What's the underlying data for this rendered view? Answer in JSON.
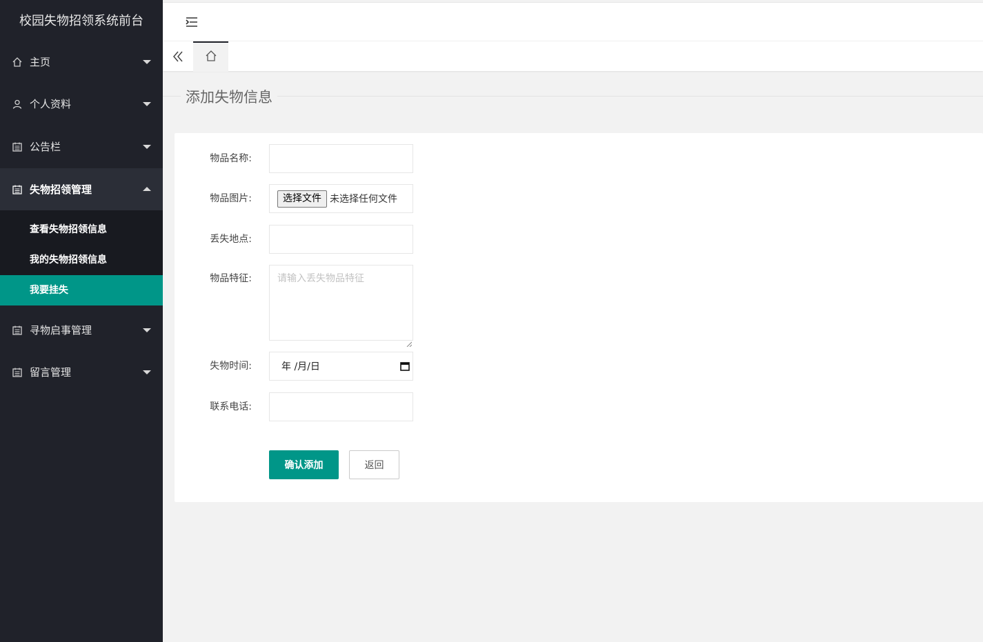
{
  "sidebar": {
    "brand": "校园失物招领系统前台",
    "items": [
      {
        "label": "主页",
        "icon": "home-icon"
      },
      {
        "label": "个人资料",
        "icon": "user-icon"
      },
      {
        "label": "公告栏",
        "icon": "calendar-icon"
      },
      {
        "label": "失物招领管理",
        "icon": "calendar-icon",
        "open": true,
        "children": [
          {
            "label": "查看失物招领信息"
          },
          {
            "label": "我的失物招领信息"
          },
          {
            "label": "我要挂失",
            "active": true
          }
        ]
      },
      {
        "label": "寻物启事管理",
        "icon": "calendar-icon"
      },
      {
        "label": "留言管理",
        "icon": "calendar-icon"
      }
    ]
  },
  "page": {
    "title": "添加失物信息"
  },
  "form": {
    "name_label": "物品名称:",
    "image_label": "物品图片:",
    "file_button": "选择文件",
    "file_status": "未选择任何文件",
    "location_label": "丢失地点:",
    "feature_label": "物品特征:",
    "feature_placeholder": "请输入丢失物品特征",
    "time_label": "失物时间:",
    "date_value": "年 /月/日",
    "phone_label": "联系电话:",
    "submit": "确认添加",
    "back": "返回"
  },
  "colors": {
    "sidebar_bg": "#20222a",
    "accent": "#009688",
    "page_bg": "#f2f2f2"
  }
}
